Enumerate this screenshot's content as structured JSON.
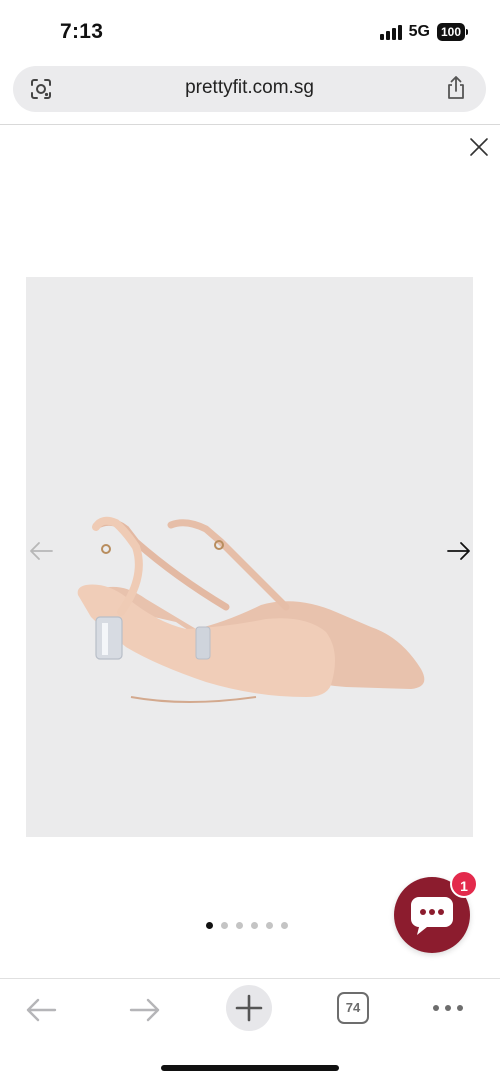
{
  "status_bar": {
    "time": "7:13",
    "network": "5G",
    "battery": "100"
  },
  "browser": {
    "url": "prettyfit.com.sg",
    "icons": {
      "left": "camera-lens-icon",
      "right": "share-icon"
    }
  },
  "gallery": {
    "close_icon": "close-icon",
    "prev_icon": "arrow-left-icon",
    "next_icon": "arrow-right-icon",
    "slide_count": 6,
    "active_slide": 1,
    "background": "#ebebec"
  },
  "chat": {
    "badge_count": "1",
    "color": "#8c1c2e",
    "badge_color": "#e32a4c"
  },
  "toolbar": {
    "tab_count": "74",
    "icons": [
      "back-icon",
      "forward-icon",
      "plus-icon",
      "tabs-icon",
      "more-icon"
    ]
  }
}
